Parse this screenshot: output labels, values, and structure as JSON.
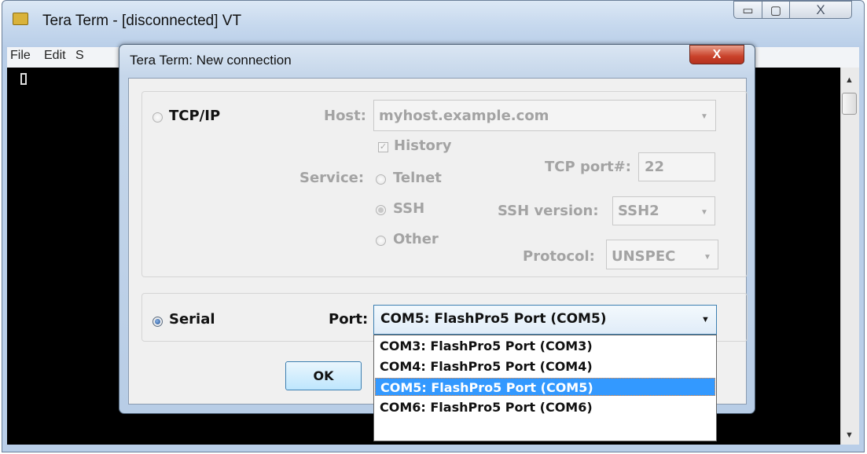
{
  "main_window": {
    "title": "Tera Term - [disconnected] VT",
    "caption_buttons": {
      "minimize": "▭",
      "maximize": "▢",
      "close": "X"
    },
    "menu": [
      "File",
      "Edit",
      "S"
    ]
  },
  "dialog": {
    "title": "Tera Term: New connection",
    "close_glyph": "X",
    "tcpip": {
      "radio_label": "TCP/IP",
      "host_label": "Host:",
      "host_value": "myhost.example.com",
      "history_label": "History",
      "history_checked": true,
      "service_label": "Service:",
      "service_options": [
        "Telnet",
        "SSH",
        "Other"
      ],
      "service_selected": "SSH",
      "tcp_port_label": "TCP port#:",
      "tcp_port_value": "22",
      "ssh_version_label": "SSH version:",
      "ssh_version_value": "SSH2",
      "protocol_label": "Protocol:",
      "protocol_value": "UNSPEC",
      "enabled": false
    },
    "serial": {
      "radio_label": "Serial",
      "selected": true,
      "port_label": "Port:",
      "port_value": "COM5: FlashPro5 Port (COM5)",
      "port_options": [
        "COM3: FlashPro5 Port (COM3)",
        "COM4: FlashPro5 Port (COM4)",
        "COM5: FlashPro5 Port (COM5)",
        "COM6: FlashPro5 Port (COM6)"
      ],
      "highlighted_option": "COM5: FlashPro5 Port (COM5)"
    },
    "ok_label": "OK"
  },
  "colors": {
    "selection": "#3399ff",
    "disabled_text": "#a3a3a3",
    "close_red": "#c9412a"
  }
}
